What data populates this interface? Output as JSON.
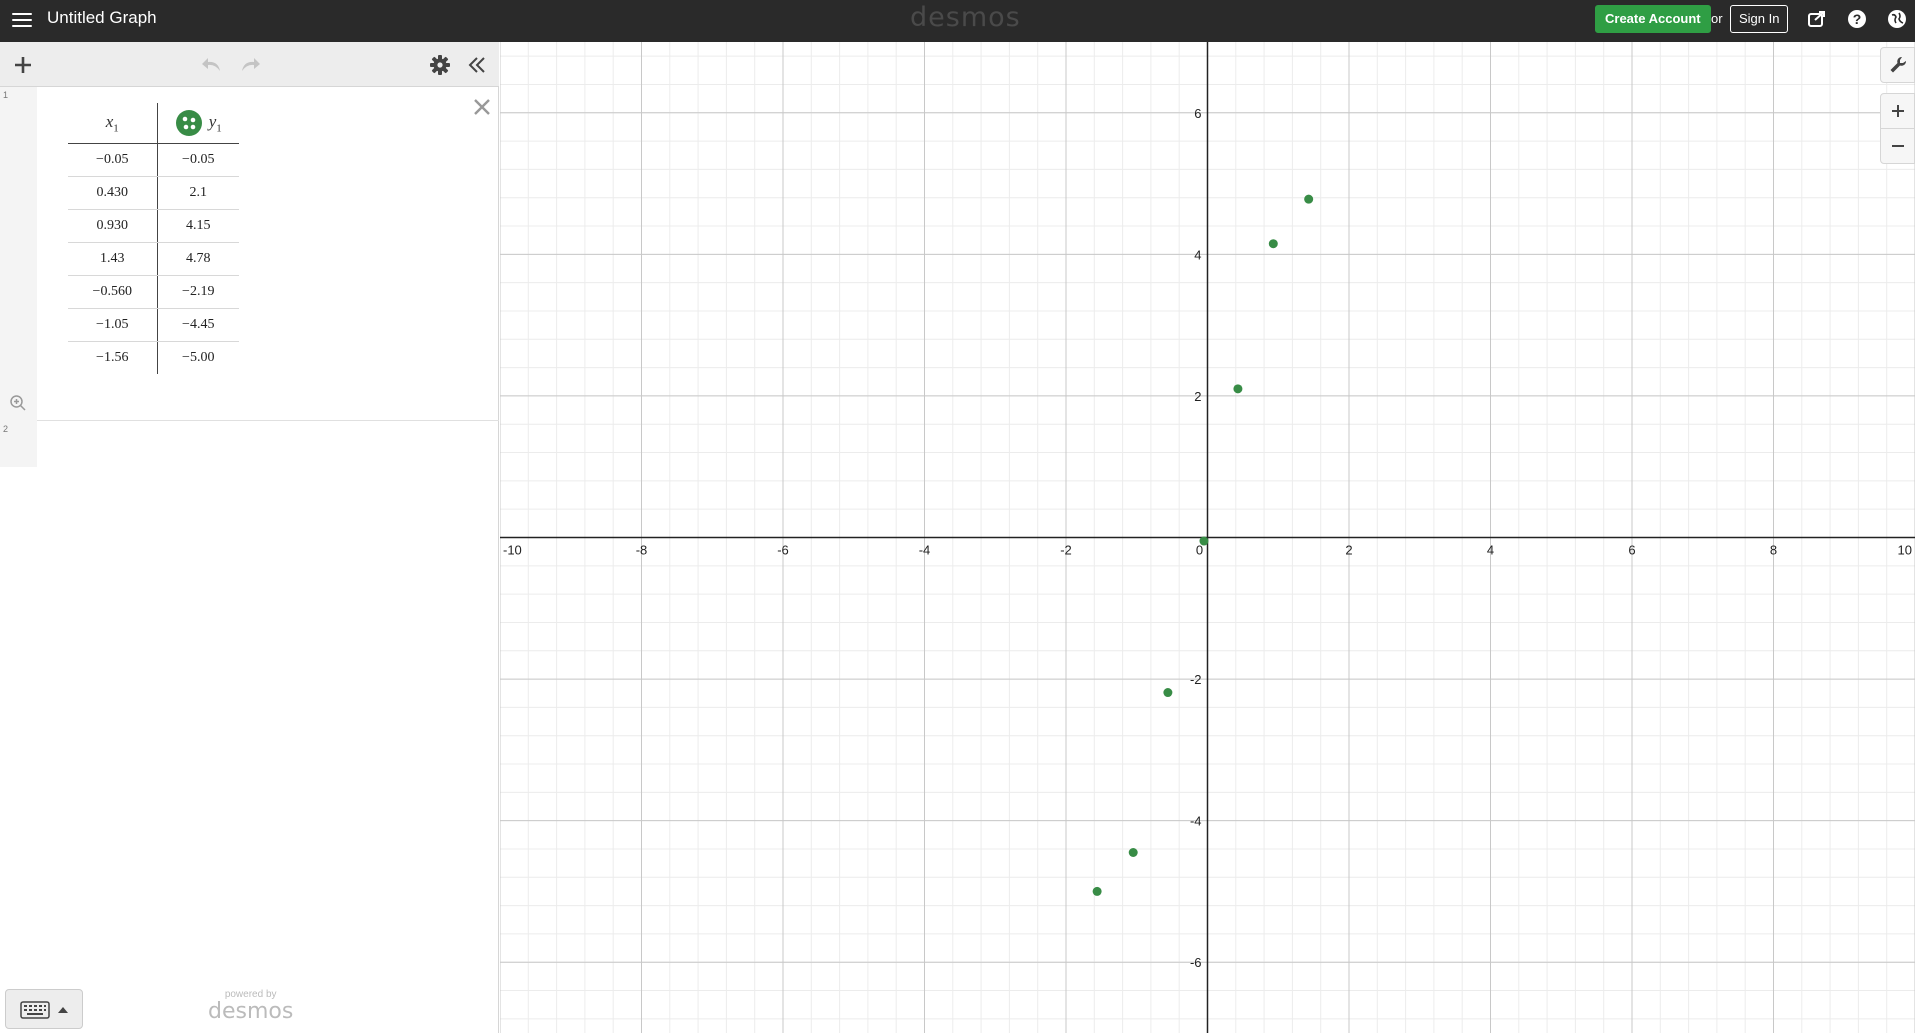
{
  "header": {
    "title": "Untitled Graph",
    "brand": "desmos",
    "create_account": "Create Account",
    "or": "or",
    "sign_in": "Sign In",
    "icons": [
      "menu-icon",
      "share-icon",
      "help-icon",
      "globe-icon"
    ]
  },
  "panel": {
    "toolbar_icons": [
      "plus-icon",
      "undo-icon",
      "redo-icon",
      "gear-icon",
      "collapse-icon"
    ],
    "expressions": [
      {
        "index": "1",
        "type": "table",
        "columns": [
          {
            "var": "x",
            "sub": "1"
          },
          {
            "var": "y",
            "sub": "1"
          }
        ],
        "rows": [
          [
            "−0.05",
            "−0.05"
          ],
          [
            "0.430",
            "2.1"
          ],
          [
            "0.930",
            "4.15"
          ],
          [
            "1.43",
            "4.78"
          ],
          [
            "−0.560",
            "−2.19"
          ],
          [
            "−1.05",
            "−4.45"
          ],
          [
            "−1.56",
            "−5.00"
          ]
        ],
        "color": "#388c46"
      },
      {
        "index": "2",
        "type": "empty"
      }
    ],
    "powered_by": "powered by",
    "powered_brand": "desmos"
  },
  "graph": {
    "tools": [
      "wrench-icon",
      "zoom-in-icon",
      "zoom-out-icon"
    ],
    "grid": true,
    "xlim": [
      -10,
      10
    ],
    "ylim": [
      -7,
      7
    ],
    "x_ticks": [
      "-10",
      "-8",
      "-6",
      "-4",
      "-2",
      "0",
      "2",
      "4",
      "6",
      "8",
      "10"
    ],
    "y_ticks": [
      "6",
      "4",
      "2",
      "-2",
      "-4",
      "-6"
    ]
  },
  "chart_data": {
    "type": "scatter",
    "series": [
      {
        "x": [
          -0.05,
          0.43,
          0.93,
          1.43,
          -0.56,
          -1.05,
          -1.56
        ],
        "y": [
          -0.05,
          2.1,
          4.15,
          4.78,
          -2.19,
          -4.45,
          -5.0
        ],
        "color": "#388c46"
      }
    ],
    "xlim": [
      -10,
      10
    ],
    "ylim": [
      -7,
      7
    ],
    "grid": true
  }
}
